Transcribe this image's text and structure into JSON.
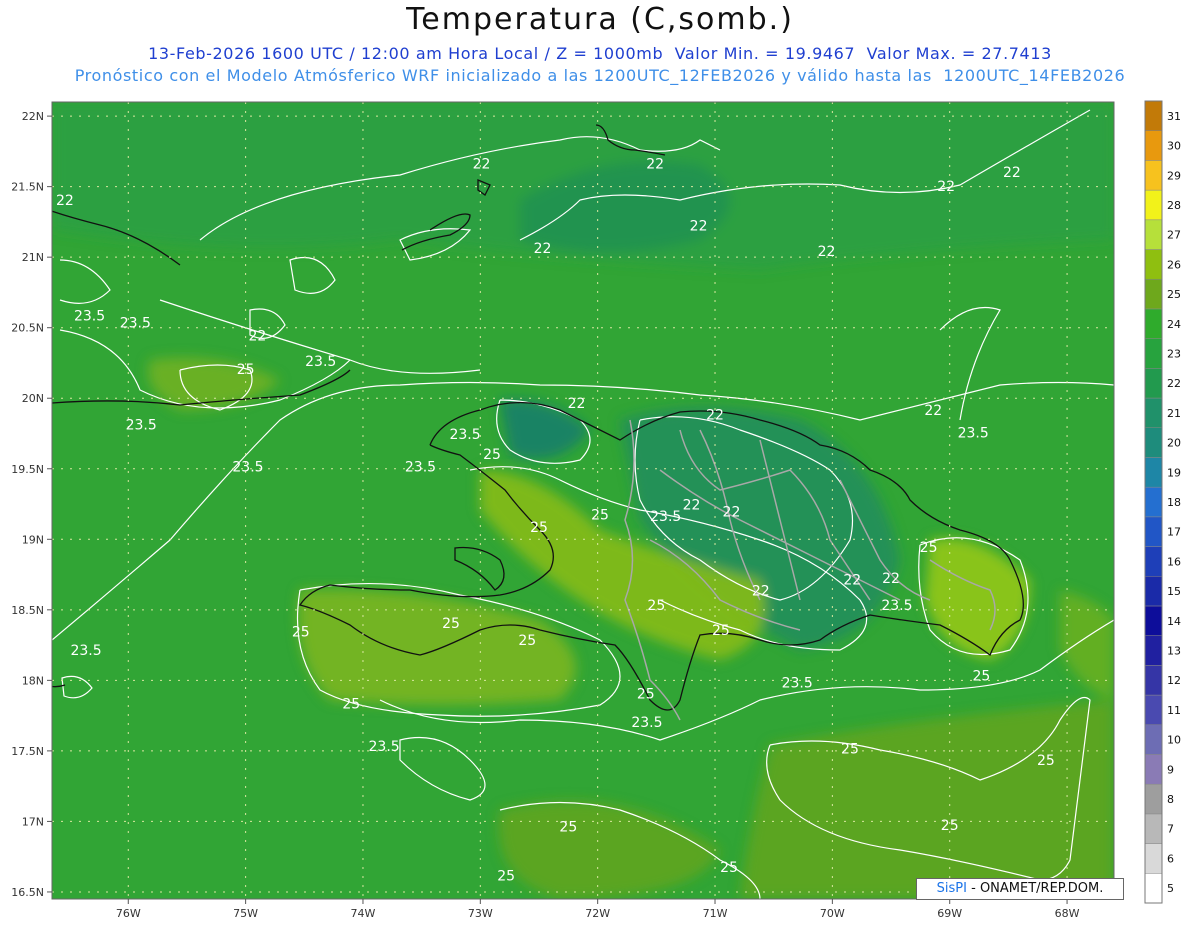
{
  "title": "Temperatura (C,somb.)",
  "subtitle_line1": "13-Feb-2026 1600 UTC / 12:00 am Hora Local / Z = 1000mb  Valor Min. = 19.9467  Valor Max. = 27.7413",
  "subtitle_line2": "Pronóstico con el Modelo Atmósferico WRF inicializado a las 1200UTC_12FEB2026 y válido hasta las  1200UTC_14FEB2026",
  "credit": {
    "brand": "SisPI",
    "text": " - ONAMET/REP.DOM."
  },
  "map": {
    "lat_ticks": [
      "22N",
      "21.5N",
      "21N",
      "20.5N",
      "20N",
      "19.5N",
      "19N",
      "18.5N",
      "18N",
      "17.5N",
      "17N",
      "16.5N"
    ],
    "lon_ticks": [
      "76W",
      "75W",
      "74W",
      "73W",
      "72W",
      "71W",
      "70W",
      "69W",
      "68W"
    ],
    "colors": {
      "base_green": "#31a535",
      "grid": "#d9e8a0",
      "coast": "#111111",
      "border": "#a8a8a8",
      "contour": "#ffffff"
    },
    "contour_labels": [
      {
        "text": "22",
        "lon": -72.99,
        "lat": 21.63
      },
      {
        "text": "22",
        "lon": -71.51,
        "lat": 21.63
      },
      {
        "text": "22",
        "lon": -76.54,
        "lat": 21.37
      },
      {
        "text": "22",
        "lon": -72.47,
        "lat": 21.03
      },
      {
        "text": "22",
        "lon": -71.14,
        "lat": 21.19
      },
      {
        "text": "22",
        "lon": -70.05,
        "lat": 21.01
      },
      {
        "text": "22",
        "lon": -69.03,
        "lat": 21.47
      },
      {
        "text": "22",
        "lon": -68.47,
        "lat": 21.57
      },
      {
        "text": "22",
        "lon": -74.9,
        "lat": 20.41
      },
      {
        "text": "22",
        "lon": -72.18,
        "lat": 19.93
      },
      {
        "text": "22",
        "lon": -71.0,
        "lat": 19.85
      },
      {
        "text": "22",
        "lon": -69.14,
        "lat": 19.88
      },
      {
        "text": "22",
        "lon": -71.2,
        "lat": 19.21
      },
      {
        "text": "22",
        "lon": -70.86,
        "lat": 19.16
      },
      {
        "text": "22",
        "lon": -70.61,
        "lat": 18.6
      },
      {
        "text": "22",
        "lon": -69.83,
        "lat": 18.68
      },
      {
        "text": "22",
        "lon": -69.5,
        "lat": 18.69
      },
      {
        "text": "23.5",
        "lon": -76.33,
        "lat": 20.55
      },
      {
        "text": "23.5",
        "lon": -75.94,
        "lat": 20.5
      },
      {
        "text": "23.5",
        "lon": -74.36,
        "lat": 20.23
      },
      {
        "text": "23.5",
        "lon": -75.89,
        "lat": 19.78
      },
      {
        "text": "23.5",
        "lon": -74.98,
        "lat": 19.48
      },
      {
        "text": "23.5",
        "lon": -73.51,
        "lat": 19.48
      },
      {
        "text": "23.5",
        "lon": -73.13,
        "lat": 19.71
      },
      {
        "text": "23.5",
        "lon": -71.42,
        "lat": 19.13
      },
      {
        "text": "23.5",
        "lon": -68.8,
        "lat": 19.72
      },
      {
        "text": "23.5",
        "lon": -69.45,
        "lat": 18.5
      },
      {
        "text": "23.5",
        "lon": -70.3,
        "lat": 17.95
      },
      {
        "text": "23.5",
        "lon": -73.82,
        "lat": 17.5
      },
      {
        "text": "23.5",
        "lon": -71.58,
        "lat": 17.67
      },
      {
        "text": "23.5",
        "lon": -76.36,
        "lat": 18.18
      },
      {
        "text": "25",
        "lon": -75.0,
        "lat": 20.17
      },
      {
        "text": "25",
        "lon": -72.9,
        "lat": 19.57
      },
      {
        "text": "25",
        "lon": -72.5,
        "lat": 19.05
      },
      {
        "text": "25",
        "lon": -71.98,
        "lat": 19.14
      },
      {
        "text": "25",
        "lon": -69.18,
        "lat": 18.91
      },
      {
        "text": "25",
        "lon": -74.53,
        "lat": 18.31
      },
      {
        "text": "25",
        "lon": -73.25,
        "lat": 18.37
      },
      {
        "text": "25",
        "lon": -72.6,
        "lat": 18.25
      },
      {
        "text": "25",
        "lon": -71.5,
        "lat": 18.5
      },
      {
        "text": "25",
        "lon": -70.95,
        "lat": 18.32
      },
      {
        "text": "25",
        "lon": -74.1,
        "lat": 17.8
      },
      {
        "text": "25",
        "lon": -71.59,
        "lat": 17.87
      },
      {
        "text": "25",
        "lon": -69.85,
        "lat": 17.48
      },
      {
        "text": "25",
        "lon": -68.73,
        "lat": 18.0
      },
      {
        "text": "25",
        "lon": -68.18,
        "lat": 17.4
      },
      {
        "text": "25",
        "lon": -72.25,
        "lat": 16.93
      },
      {
        "text": "25",
        "lon": -70.88,
        "lat": 16.64
      },
      {
        "text": "25",
        "lon": -72.78,
        "lat": 16.58
      },
      {
        "text": "25",
        "lon": -69.0,
        "lat": 16.94
      }
    ]
  },
  "colorbar": {
    "levels": [
      "5",
      "6",
      "7",
      "8",
      "9",
      "10",
      "11",
      "12",
      "13",
      "14",
      "15",
      "16",
      "17",
      "18",
      "19",
      "20",
      "21",
      "22",
      "23",
      "24",
      "25",
      "26",
      "27",
      "28",
      "29",
      "30",
      "31"
    ],
    "colors": [
      "#ffffff",
      "#d9d9d9",
      "#b8b8b8",
      "#9e9e9e",
      "#8a7bb5",
      "#6d6db4",
      "#4a4ab0",
      "#3535a6",
      "#2020a0",
      "#0d0d9a",
      "#1a2aa8",
      "#1e3fb8",
      "#2156c6",
      "#246fd0",
      "#1e86a6",
      "#1e8c7c",
      "#20916a",
      "#229a4e",
      "#27a33e",
      "#2fab2c",
      "#6ea81c",
      "#8fbf10",
      "#b6e03a",
      "#f2f21a",
      "#f7c21e",
      "#e8990e",
      "#c27a08"
    ]
  }
}
